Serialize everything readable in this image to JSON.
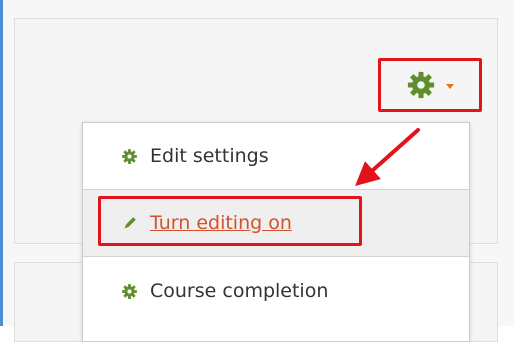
{
  "menu": {
    "items": [
      {
        "label": "Edit settings",
        "icon": "gear-icon"
      },
      {
        "label": "Turn editing on",
        "icon": "pencil-icon"
      },
      {
        "label": "Course completion",
        "icon": "gear-icon"
      }
    ]
  },
  "colors": {
    "gear": "#5f8e2c",
    "caret": "#e8731e",
    "link": "#d5512d",
    "annotation": "#e3131b",
    "accent_border": "#4a8fd1"
  }
}
